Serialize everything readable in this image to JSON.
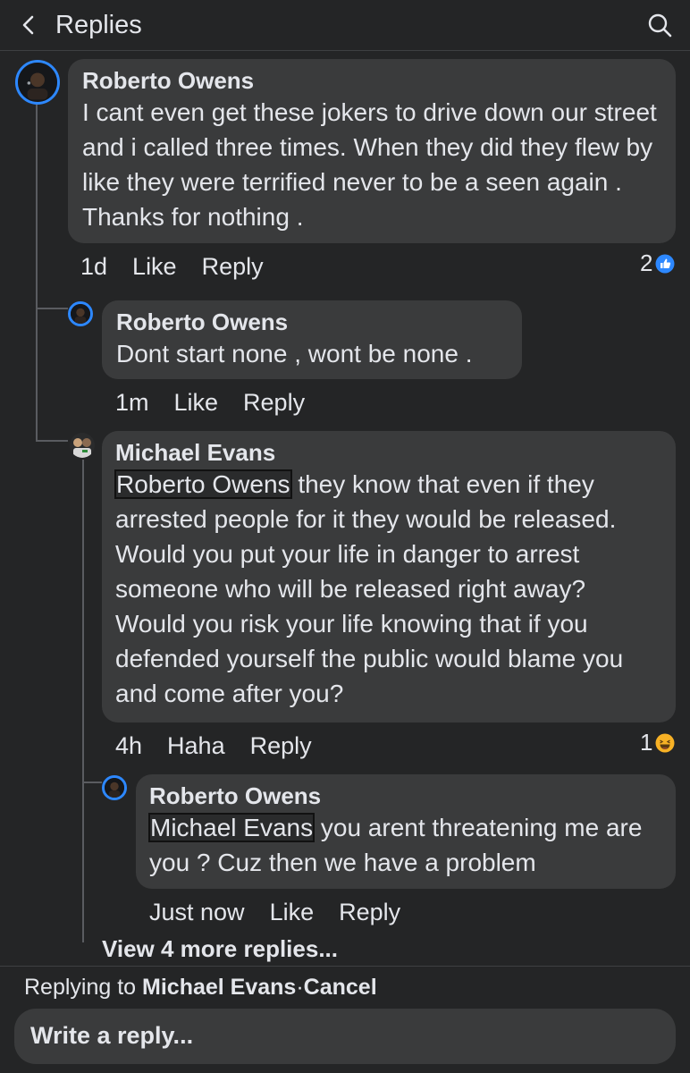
{
  "header": {
    "title": "Replies"
  },
  "comments": [
    {
      "author": "Roberto Owens",
      "text": "I cant even get these jokers to drive down our street and i called three times. When they did they flew by like they were terrified never to be a seen again . Thanks for nothing .",
      "time": "1d",
      "action1": "Like",
      "action2": "Reply",
      "reaction_count": "2",
      "reaction_type": "like-icon"
    },
    {
      "author": "Roberto Owens",
      "text": "Dont start none , wont be none .",
      "time": "1m",
      "action1": "Like",
      "action2": "Reply"
    },
    {
      "author": "Michael Evans",
      "mention": "Roberto Owens",
      "text": " they know that even if they arrested people for it they would be released.  Would you put your life in danger to arrest someone who will be released right away?  Would you risk your life knowing that if you defended yourself the public would blame you and come after you?",
      "time": "4h",
      "action1": "Haha",
      "action2": "Reply",
      "reaction_count": "1",
      "reaction_type": "haha-icon"
    },
    {
      "author": "Roberto Owens",
      "mention": "Michael Evans",
      "text": " you arent threatening me are you ? Cuz then we have a problem",
      "time": "Just now",
      "action1": "Like",
      "action2": "Reply"
    }
  ],
  "view_more": "View 4 more replies...",
  "footer": {
    "replying_prefix": "Replying to ",
    "replying_name": "Michael Evans",
    "separator": "·",
    "cancel": "Cancel",
    "placeholder": "Write a reply..."
  },
  "colors": {
    "background": "#242526",
    "bubble": "#3a3b3c",
    "accent": "#2d88ff",
    "text": "#e4e6eb"
  }
}
